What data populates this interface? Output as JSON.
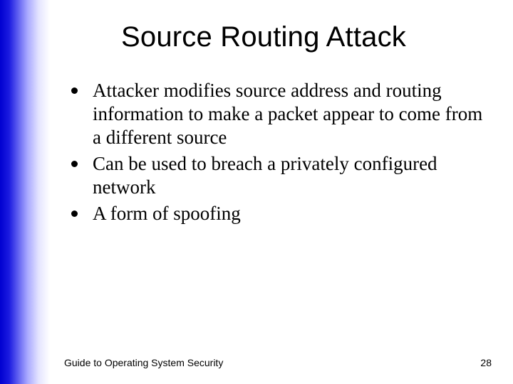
{
  "title": "Source Routing Attack",
  "bullets": [
    "Attacker modifies source address and routing information to make a packet appear to come from a different source",
    "Can be used to breach a privately configured network",
    "A form of spoofing"
  ],
  "footer": "Guide to Operating System Security",
  "page_number": "28"
}
